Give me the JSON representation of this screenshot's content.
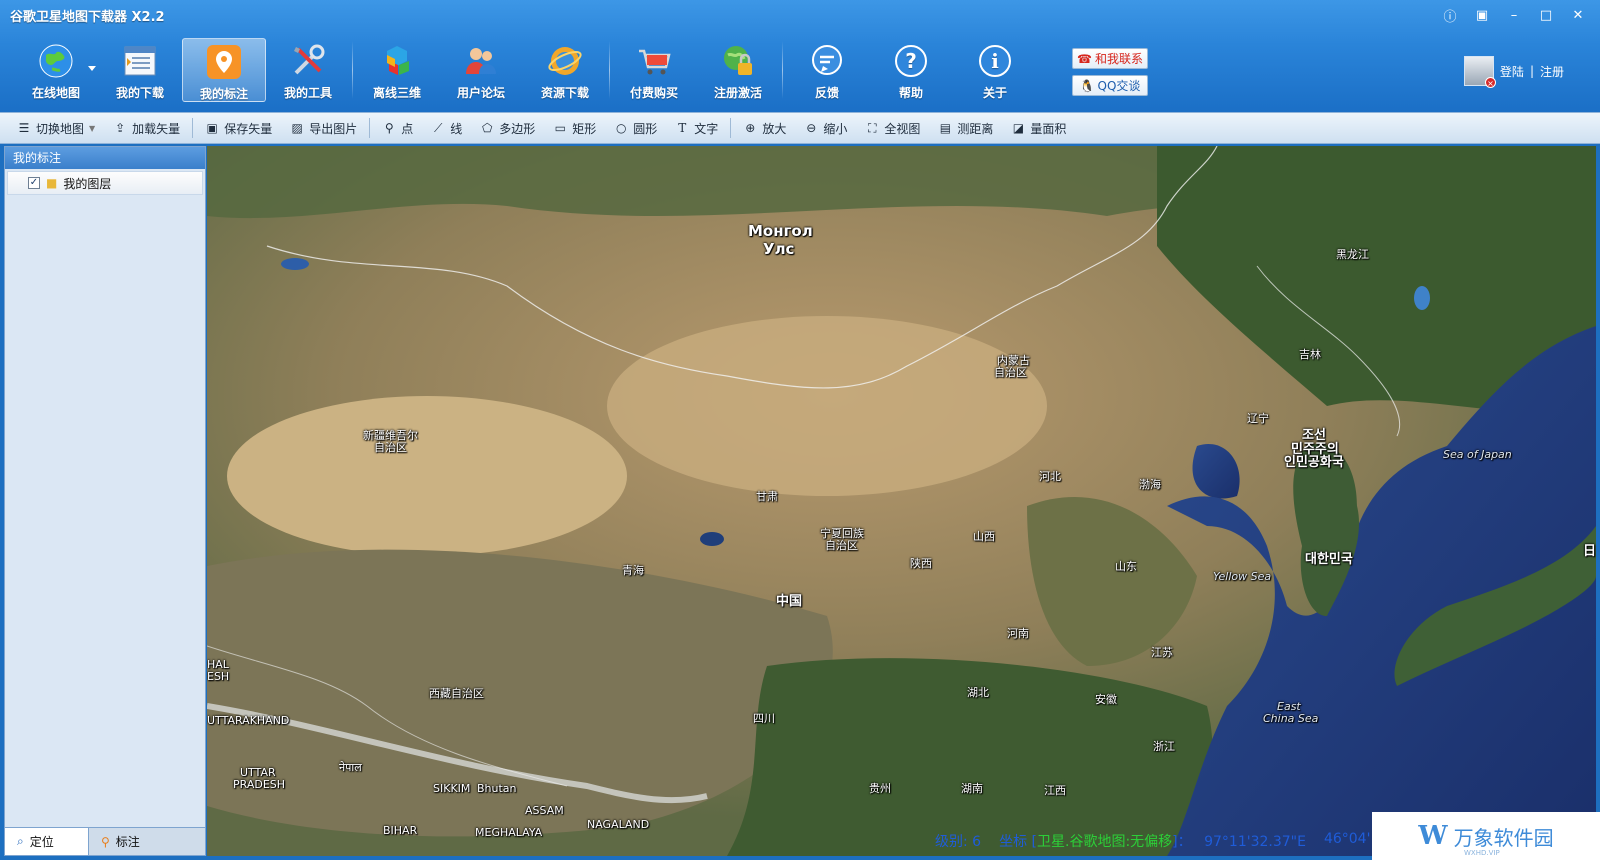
{
  "window": {
    "title": "谷歌卫星地图下载器 X2.2",
    "controls": [
      "ⓘ",
      "▣",
      "–",
      "□",
      "✕"
    ]
  },
  "toolbar": {
    "items": [
      {
        "label": "在线地图",
        "icon": "globe-icon"
      },
      {
        "label": "我的下载",
        "icon": "download-list-icon"
      },
      {
        "label": "我的标注",
        "icon": "map-pin-icon",
        "active": true
      },
      {
        "label": "我的工具",
        "icon": "tools-icon"
      },
      {
        "label": "离线三维",
        "icon": "cubes-icon"
      },
      {
        "label": "用户论坛",
        "icon": "users-icon"
      },
      {
        "label": "资源下载",
        "icon": "ie-globe-icon"
      },
      {
        "label": "付费购买",
        "icon": "shopping-cart-icon"
      },
      {
        "label": "注册激活",
        "icon": "lock-globe-icon"
      },
      {
        "label": "反馈",
        "icon": "chat-bubble-icon"
      },
      {
        "label": "帮助",
        "icon": "question-icon"
      },
      {
        "label": "关于",
        "icon": "info-icon"
      }
    ]
  },
  "contact": {
    "contact_me": "和我联系",
    "qq_chat": "QQ交谈"
  },
  "user": {
    "login": "登陆",
    "sep": "|",
    "register": "注册"
  },
  "toolbar2": {
    "switch_map": "切换地图",
    "load_vector": "加载矢量",
    "save_vector": "保存矢量",
    "export_image": "导出图片",
    "point": "点",
    "line": "线",
    "polygon": "多边形",
    "rectangle": "矩形",
    "circle": "圆形",
    "text": "文字",
    "zoom_in": "放大",
    "zoom_out": "缩小",
    "full_view": "全视图",
    "measure_distance": "测距离",
    "measure_area": "量面积"
  },
  "left_panel": {
    "header": "我的标注",
    "layer_name": "我的图层",
    "tab_locate": "定位",
    "tab_mark": "标注"
  },
  "map_labels": {
    "mongolia_1": "Монгол",
    "mongolia_2": "Улс",
    "heilongjiang": "黑龙江",
    "jilin": "吉林",
    "liaoning": "辽宁",
    "nei_1": "内蒙古",
    "nei_2": "自治区",
    "xinjiang_1": "新疆维吾尔",
    "xinjiang_2": "自治区",
    "gansu": "甘肃",
    "ningxia_1": "宁夏回族",
    "ningxia_2": "自治区",
    "qinghai": "青海",
    "shanxi": "山西",
    "shaanxi": "陕西",
    "hebei": "河北",
    "bohai": "渤海",
    "shandong": "山东",
    "henan": "河南",
    "jiangsu": "江苏",
    "anhui": "安徽",
    "hubei": "湖北",
    "sichuan": "四川",
    "zhejiang": "浙江",
    "guizhou": "贵州",
    "hunan": "湖南",
    "jiangxi": "江西",
    "xizang": "西藏自治区",
    "china": "中国",
    "nk_1": "조선",
    "nk_2": "민주주의",
    "nk_3": "인민공화국",
    "sk": "대한민국",
    "sea_japan": "Sea of Japan",
    "yellow_sea": "Yellow Sea",
    "ecs_1": "East",
    "ecs_2": "China Sea",
    "himachal_1": "HAL",
    "himachal_2": "ESH",
    "uttarakhand": "UTTARAKHAND",
    "up_1": "UTTAR",
    "up_2": "PRADESH",
    "nepal": "नेपाल",
    "sikkim": "SIKKIM",
    "bhutan": "Bhutan",
    "assam": "ASSAM",
    "nagaland": "NAGALAND",
    "bihar": "BIHAR",
    "meghalaya": "MEGHALAYA",
    "japan_partial": "日"
  },
  "status": {
    "level": "级别: 6",
    "coord_prefix": "坐标 [",
    "coord_source": "卫星.谷歌地图:无偏移",
    "coord_suffix": "]：",
    "longitude": "97°11'32.37\"E",
    "latitude": "46°04'"
  },
  "watermark": {
    "logo": "W",
    "text": "万象软件园",
    "sub": "WXHD.VIP"
  },
  "colors": {
    "title_bar": "#2a84d9",
    "status_text": "#1f5cd8",
    "status_green": "#2ccf38"
  }
}
